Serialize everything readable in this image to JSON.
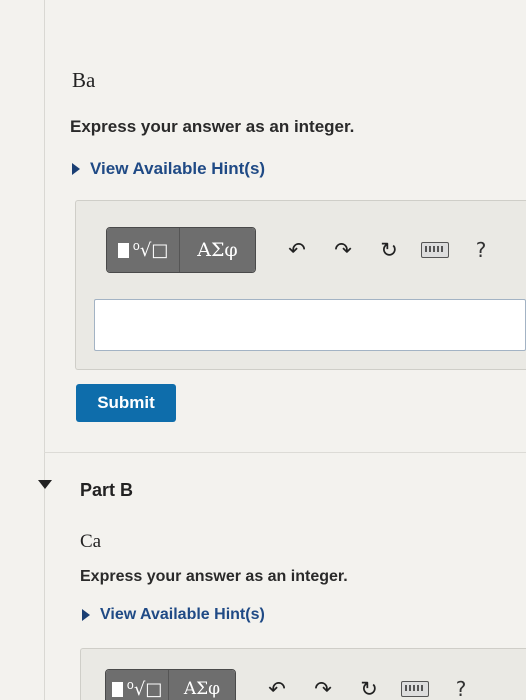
{
  "part_a": {
    "element": "Ba",
    "instruction": "Express your answer as an integer.",
    "hint_link": "View Available Hint(s)",
    "toolbar": {
      "template_icon": "radical-template-icon",
      "symbols_label": "ΑΣφ",
      "undo_glyph": "↶",
      "redo_glyph": "↷",
      "reset_glyph": "↻",
      "help_label": "?"
    },
    "answer_value": "",
    "submit_label": "Submit"
  },
  "part_b": {
    "title": "Part B",
    "element": "Ca",
    "instruction": "Express your answer as an integer.",
    "hint_link": "View Available Hint(s)",
    "toolbar": {
      "symbols_label": "ΑΣφ",
      "undo_glyph": "↶",
      "redo_glyph": "↷",
      "reset_glyph": "↻",
      "help_label": "?"
    }
  },
  "colors": {
    "link": "#1f4a85",
    "submit_bg": "#0e6dab",
    "toolbar_btn": "#6e6e6e",
    "background": "#f3f2ee"
  }
}
